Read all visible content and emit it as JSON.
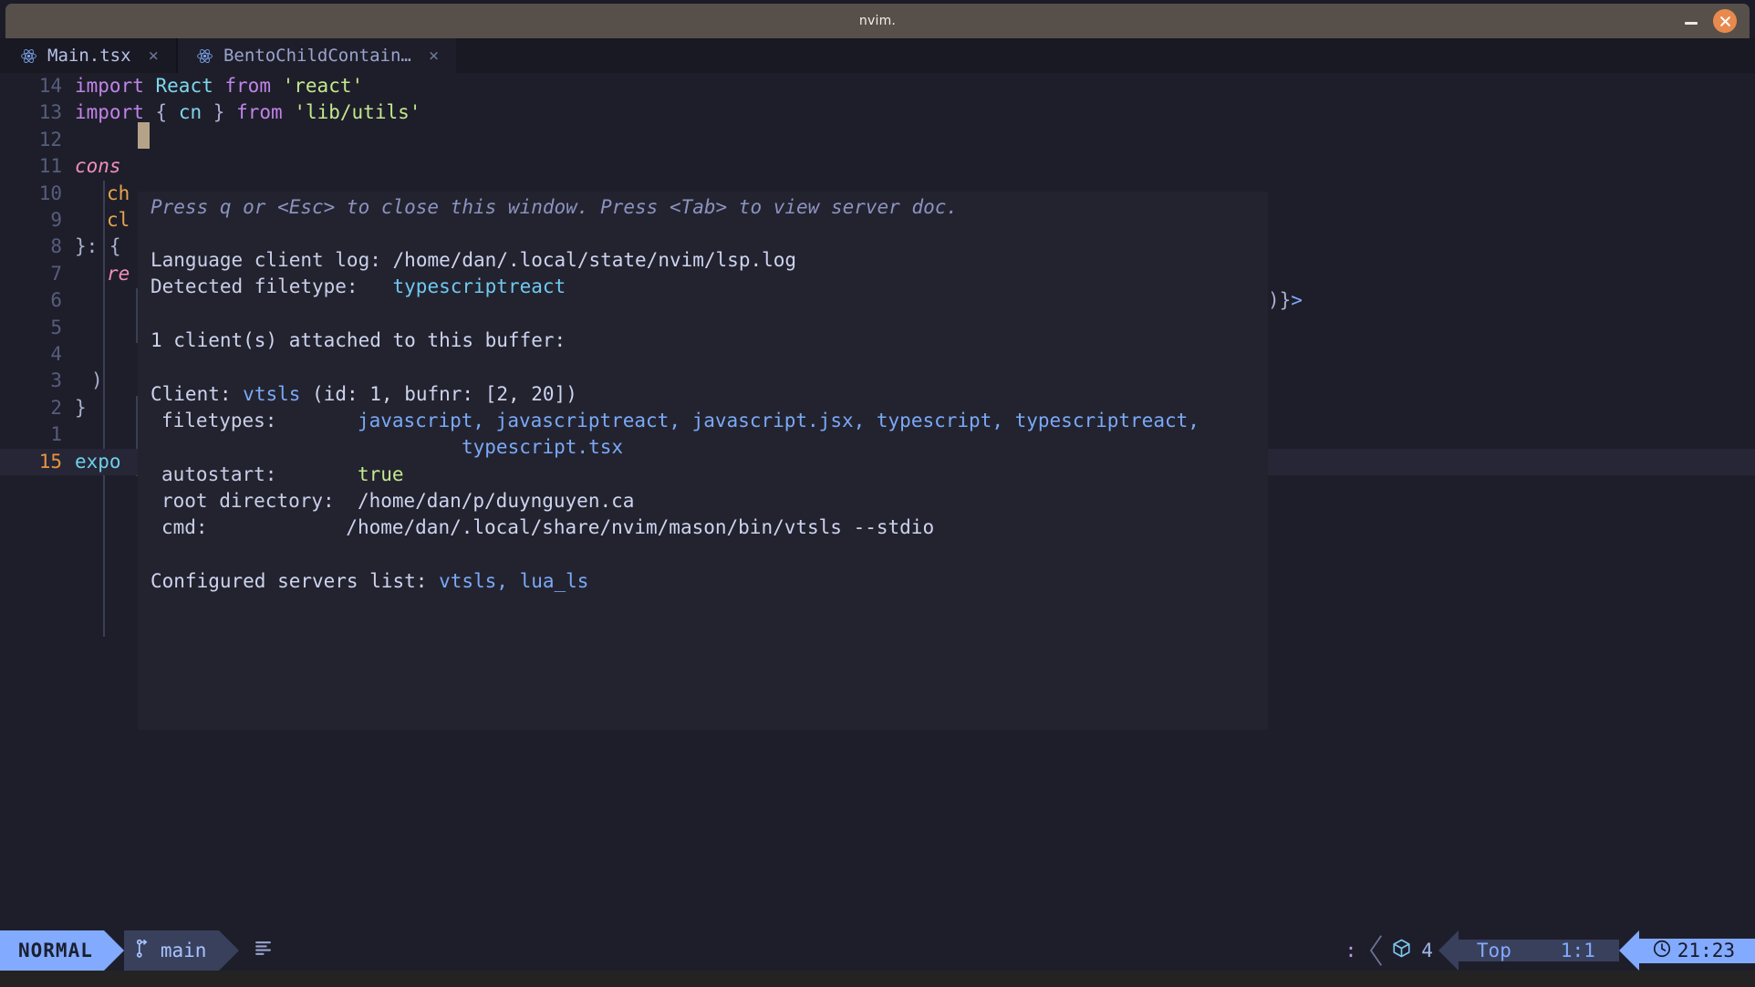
{
  "window": {
    "title": "nvim.",
    "minimize_icon": "minimize-icon",
    "close_icon": "close-icon",
    "accent_close": "#e88a4e",
    "titlebar_bg": "#574f4a"
  },
  "tabs": [
    {
      "label": "Main.tsx",
      "icon": "react-icon",
      "close": "×",
      "active": true
    },
    {
      "label": "BentoChildContain…",
      "icon": "react-icon",
      "close": "×",
      "active": false
    }
  ],
  "editor": {
    "bg": "#1e1e2a",
    "lines": [
      {
        "num": "14",
        "current": false
      },
      {
        "num": "13",
        "current": false
      },
      {
        "num": "12",
        "current": false
      },
      {
        "num": "11",
        "current": false
      },
      {
        "num": "10",
        "current": false
      },
      {
        "num": "9",
        "current": false
      },
      {
        "num": "8",
        "current": false
      },
      {
        "num": "7",
        "current": false
      },
      {
        "num": "6",
        "current": false
      },
      {
        "num": "5",
        "current": false
      },
      {
        "num": "4",
        "current": false
      },
      {
        "num": "3",
        "current": false
      },
      {
        "num": "2",
        "current": false
      },
      {
        "num": "1",
        "current": false
      },
      {
        "num": "15",
        "current": true
      }
    ],
    "code": {
      "l14_import": "import",
      "l14_react": "React",
      "l14_from": "from",
      "l14_mod": "'react'",
      "l13_import": "import",
      "l13_open": "{",
      "l13_cn": "cn",
      "l13_close": "}",
      "l13_from": "from",
      "l13_mod": "'lib/utils'",
      "l11_cons": "cons",
      "l10_ch": "ch",
      "l9_cl": "cl",
      "l8_brace": "}: {",
      "l7_re": "re",
      "l3_paren": ")",
      "l2_brace": "}",
      "l15_expo": "expo",
      "l6_tail": ")}>"
    }
  },
  "float": {
    "bg": "#23232f",
    "hint": "Press q or <Esc> to close this window. Press <Tab> to view server doc.",
    "log_label": "Language client log:",
    "log_path": "/home/dan/.local/state/nvim/lsp.log",
    "filetype_label": "Detected filetype:",
    "filetype_value": "typescriptreact",
    "clients_line": "1 client(s) attached to this buffer:",
    "client_label": "Client:",
    "client_name": "vtsls",
    "client_meta": "(id: 1, bufnr: [2, 20])",
    "filetypes_label": "filetypes:",
    "filetypes_value": "javascript, javascriptreact, javascript.jsx, typescript, typescriptreact,",
    "filetypes_value2": "typescript.tsx",
    "autostart_label": "autostart:",
    "autostart_value": "true",
    "rootdir_label": "root directory:",
    "rootdir_value": "/home/dan/p/duynguyen.ca",
    "cmd_label": "cmd:",
    "cmd_value": "/home/dan/.local/share/nvim/mason/bin/vtsls --stdio",
    "servers_label": "Configured servers list:",
    "servers_value": "vtsls, lua_ls"
  },
  "statusline": {
    "mode": "NORMAL",
    "branch": "main",
    "branch_icon": "git-branch-icon",
    "lines_icon": "text-lines-icon",
    "colon_indicator": ":",
    "cube_icon": "package-icon",
    "cube_count": "4",
    "position_top": "Top",
    "position_line_col": "1:1",
    "clock_icon": "clock-icon",
    "time": "21:23",
    "accent": "#82aaff"
  }
}
